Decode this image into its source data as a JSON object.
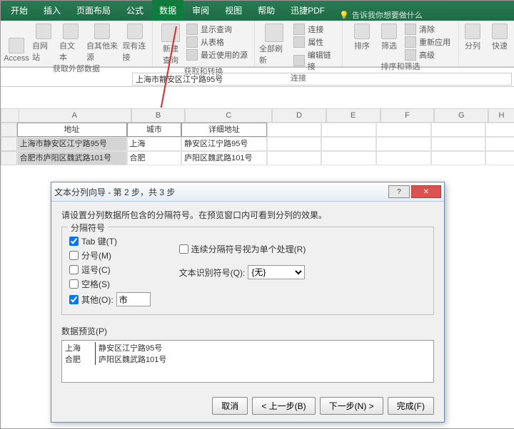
{
  "tabs": [
    "开始",
    "插入",
    "页面布局",
    "公式",
    "数据",
    "审阅",
    "视图",
    "帮助",
    "迅捷PDF"
  ],
  "active_tab": "数据",
  "tell_me": "告诉我你想要做什么",
  "ribbon": {
    "group1": {
      "icons": [
        "Access",
        "自网站",
        "自文本",
        "自其他来源",
        "现有连接"
      ],
      "label": "获取外部数据"
    },
    "group2": {
      "big": "新建\n查询",
      "list": [
        "显示查询",
        "从表格",
        "最近使用的源"
      ],
      "label": "获取和转换"
    },
    "group3": {
      "big": "全部刷新",
      "list": [
        "连接",
        "属性",
        "编辑链接"
      ],
      "label": "连接"
    },
    "group4": {
      "icons": [
        "排序",
        "筛选"
      ],
      "adv_list": [
        "清除",
        "重新应用",
        "高级"
      ],
      "label": "排序和筛选"
    },
    "group5": {
      "icons": [
        "分列",
        "快速"
      ]
    }
  },
  "formula_bar": "上海市静安区江宁路95号",
  "columns": [
    "A",
    "B",
    "C",
    "D",
    "E",
    "F",
    "G",
    "H"
  ],
  "header_row": [
    "地址",
    "城市",
    "详细地址"
  ],
  "rows": [
    [
      "上海市静安区江宁路95号",
      "上海",
      "静安区江宁路95号"
    ],
    [
      "合肥市庐阳区魏武路101号",
      "合肥",
      "庐阳区魏武路101号"
    ]
  ],
  "dialog": {
    "title": "文本分列向导 - 第 2 步，共 3 步",
    "instr": "请设置分列数据所包含的分隔符号。在预览窗口内可看到分列的效果。",
    "group_label": "分隔符号",
    "chk_tab": "Tab 键(T)",
    "chk_semi": "分号(M)",
    "chk_comma": "逗号(C)",
    "chk_space": "空格(S)",
    "chk_other": "其他(O):",
    "other_val": "市",
    "chk_consec": "连续分隔符号视为单个处理(R)",
    "text_qual_label": "文本识别符号(Q):",
    "text_qual_val": "{无}",
    "preview_label": "数据预览(P)",
    "preview": [
      [
        "上海",
        "静安区江宁路95号"
      ],
      [
        "合肥",
        "庐阳区魏武路101号"
      ]
    ],
    "btn_cancel": "取消",
    "btn_back": "< 上一步(B)",
    "btn_next": "下一步(N) >",
    "btn_finish": "完成(F)"
  }
}
